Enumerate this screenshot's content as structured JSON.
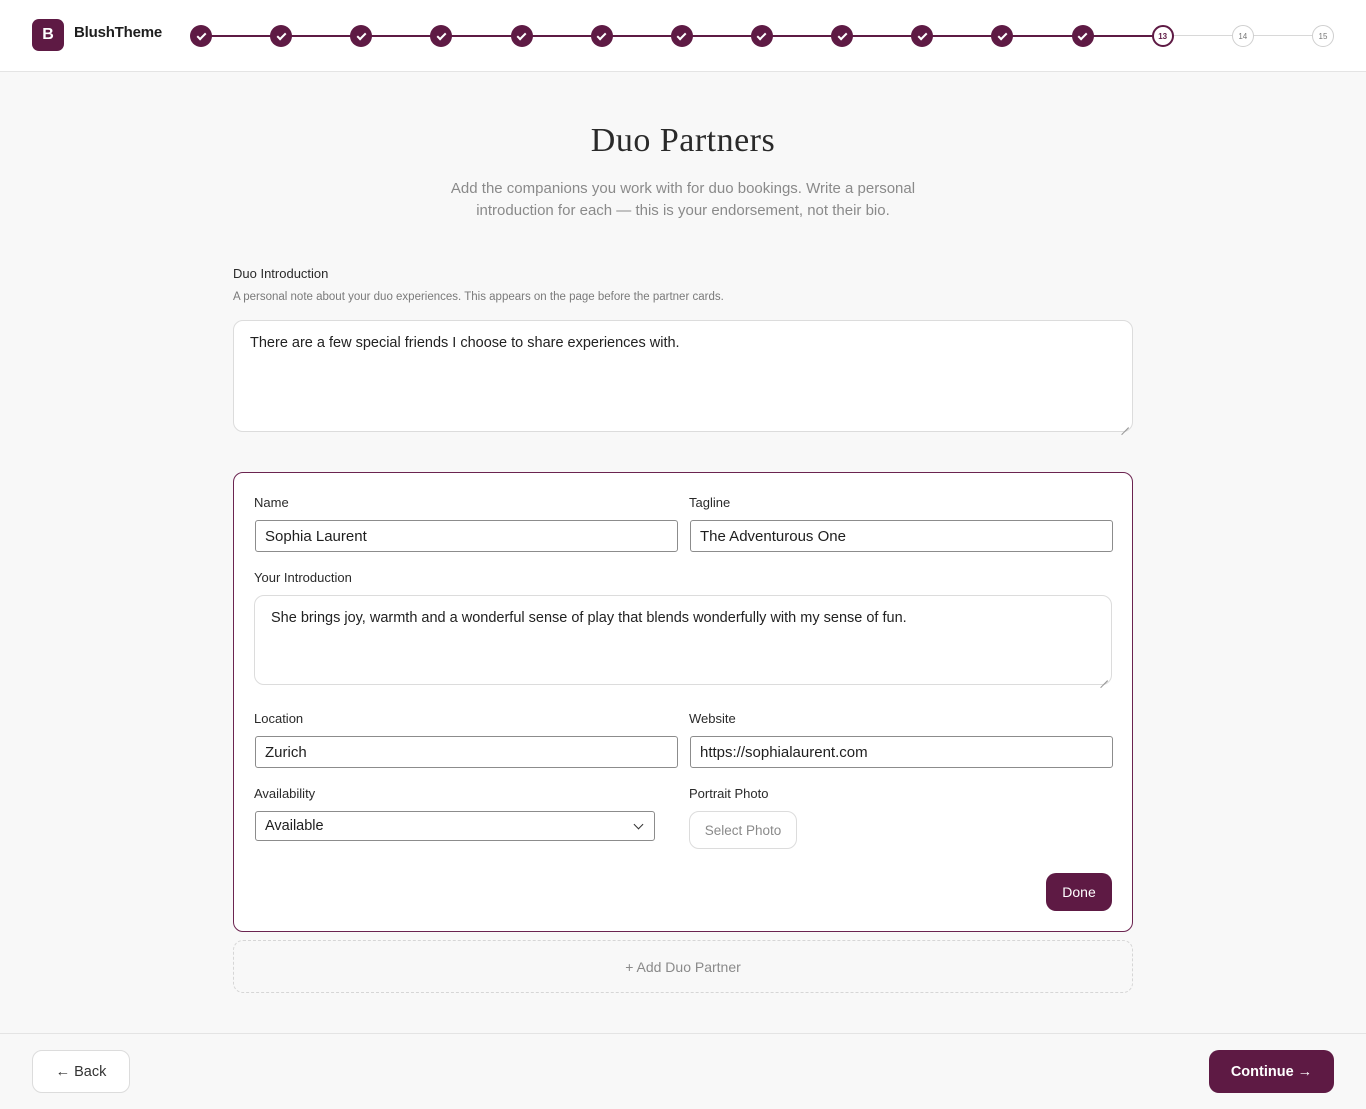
{
  "header": {
    "logo_letter": "B",
    "brand": "BlushTheme",
    "steps": [
      {
        "label": "",
        "state": "done"
      },
      {
        "label": "",
        "state": "done"
      },
      {
        "label": "",
        "state": "done"
      },
      {
        "label": "",
        "state": "done"
      },
      {
        "label": "",
        "state": "done"
      },
      {
        "label": "",
        "state": "done"
      },
      {
        "label": "",
        "state": "done"
      },
      {
        "label": "",
        "state": "done"
      },
      {
        "label": "",
        "state": "done"
      },
      {
        "label": "",
        "state": "done"
      },
      {
        "label": "",
        "state": "done"
      },
      {
        "label": "",
        "state": "done"
      },
      {
        "label": "13",
        "state": "current"
      },
      {
        "label": "14",
        "state": "todo"
      },
      {
        "label": "15",
        "state": "todo"
      }
    ]
  },
  "page": {
    "title": "Duo Partners",
    "subtitle": "Add the companions you work with for duo bookings. Write a personal introduction for each — this is your endorsement, not their bio."
  },
  "duo_intro": {
    "label": "Duo Introduction",
    "hint": "A personal note about your duo experiences. This appears on the page before the partner cards.",
    "value": "There are a few special friends I choose to share experiences with."
  },
  "partner": {
    "name_label": "Name",
    "name_value": "Sophia Laurent",
    "tagline_label": "Tagline",
    "tagline_value": "The Adventurous One",
    "intro_label": "Your Introduction",
    "intro_value": "She brings joy, warmth and a wonderful sense of play that blends wonderfully with my sense of fun.",
    "location_label": "Location",
    "location_value": "Zurich",
    "website_label": "Website",
    "website_value": "https://sophialaurent.com",
    "availability_label": "Availability",
    "availability_value": "Available",
    "photo_label": "Portrait Photo",
    "photo_button": "Select Photo",
    "done_button": "Done"
  },
  "add_partner_label": "+ Add Duo Partner",
  "footer": {
    "back_label": "← Back",
    "continue_label": "Continue →"
  },
  "colors": {
    "brand": "#5e1a44",
    "line_done": "#5e1a44",
    "line_todo": "#d8d8d8"
  }
}
